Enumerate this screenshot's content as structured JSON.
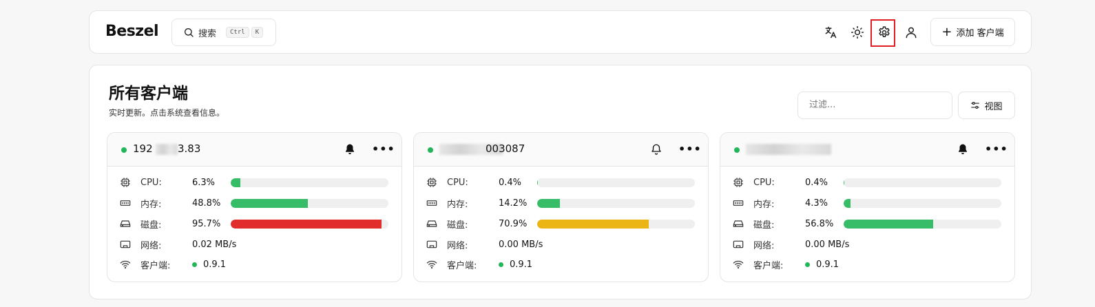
{
  "header": {
    "logo": "Beszel",
    "search_label": "搜索",
    "search_kbd": [
      "Ctrl",
      "K"
    ],
    "icons": [
      "translate-icon",
      "sun-icon",
      "settings-icon",
      "user-icon"
    ],
    "add_button": "添加 客户端"
  },
  "main": {
    "title": "所有客户端",
    "subtitle": "实时更新。点击系统查看信息。",
    "filter_placeholder": "过滤...",
    "view_button": "视图"
  },
  "labels": {
    "cpu": "CPU:",
    "mem": "内存:",
    "disk": "磁盘:",
    "net": "网络:",
    "agent": "客户端:"
  },
  "colors": {
    "green": "#37bd68",
    "red": "#e22d2d",
    "amber": "#ebb515",
    "status": "#22b559"
  },
  "cards": [
    {
      "name": "192",
      "name_tail": "3.83",
      "alerts_active": true,
      "cpu": "6.3%",
      "cpu_pct": 6.3,
      "cpu_color": "#37bd68",
      "mem": "48.8%",
      "mem_pct": 48.8,
      "mem_color": "#37bd68",
      "disk": "95.7%",
      "disk_pct": 95.7,
      "disk_color": "#e22d2d",
      "net": "0.02 MB/s",
      "agent": "0.9.1"
    },
    {
      "name": "",
      "name_tail": "003087",
      "alerts_active": false,
      "cpu": "0.4%",
      "cpu_pct": 0.4,
      "cpu_color": "#37bd68",
      "mem": "14.2%",
      "mem_pct": 14.2,
      "mem_color": "#37bd68",
      "disk": "70.9%",
      "disk_pct": 70.9,
      "disk_color": "#ebb515",
      "net": "0.00 MB/s",
      "agent": "0.9.1"
    },
    {
      "name": "",
      "name_tail": "",
      "alerts_active": true,
      "cpu": "0.4%",
      "cpu_pct": 0.4,
      "cpu_color": "#37bd68",
      "mem": "4.3%",
      "mem_pct": 4.3,
      "mem_color": "#37bd68",
      "disk": "56.8%",
      "disk_pct": 56.8,
      "disk_color": "#37bd68",
      "net": "0.00 MB/s",
      "agent": "0.9.1"
    }
  ]
}
